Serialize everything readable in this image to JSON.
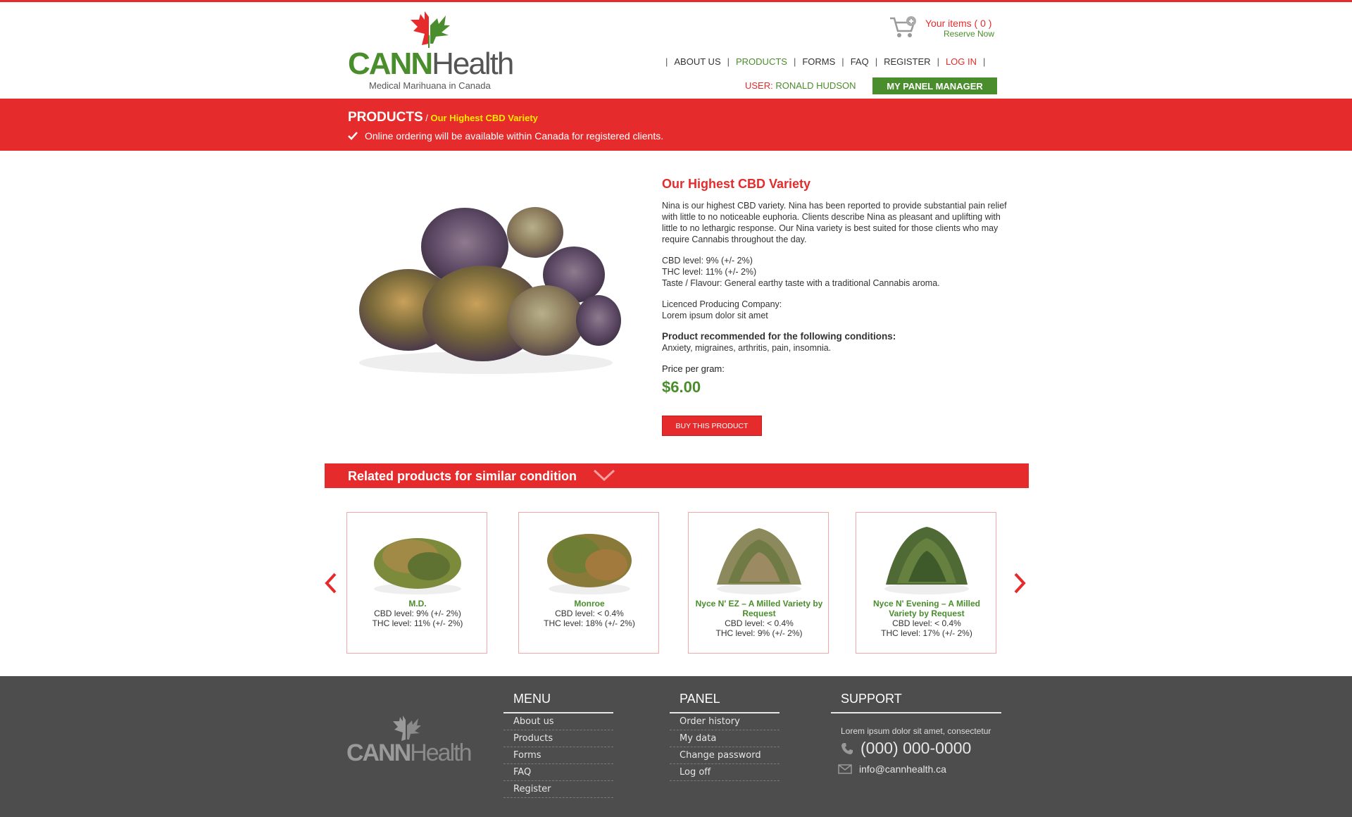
{
  "colors": {
    "brand_red": "#e52b2b",
    "brand_green": "#4a8d2c",
    "footer_bg": "#4d4d4d"
  },
  "header": {
    "logo": {
      "cann": "CANN",
      "health": "Health",
      "tagline": "Medical Marihuana in Canada"
    },
    "cart": {
      "items_label": "Your items ( 0 )",
      "reserve_label": "Reserve Now",
      "icon": "cart-icon"
    },
    "nav": [
      {
        "label": "ABOUT US"
      },
      {
        "label": "PRODUCTS"
      },
      {
        "label": "FORMS"
      },
      {
        "label": "FAQ"
      },
      {
        "label": "REGISTER"
      },
      {
        "label": "LOG IN"
      }
    ],
    "user": {
      "label": "USER:",
      "name": "RONALD HUDSON"
    },
    "panel_button": "MY PANEL  MANAGER"
  },
  "band": {
    "title": "PRODUCTS",
    "separator": " / ",
    "crumb": "Our Highest CBD Variety",
    "note": "Online ordering will be available within Canada for registered clients."
  },
  "product": {
    "title": "Our Highest CBD Variety",
    "description": "Nina is our highest CBD variety. Nina has been reported to provide substantial pain relief with little to no noticeable euphoria. Clients describe Nina as pleasant and uplifting with little to no lethargic response. Our Nina variety is best suited for those clients who may require Cannabis throughout the day.",
    "cbd": "CBD level: 9% (+/- 2%)",
    "thc": "THC level: 11% (+/- 2%)",
    "taste": "Taste / Flavour: General earthy taste with a traditional Cannabis aroma.",
    "company_label": "Licenced Producing Company:",
    "company": "Lorem ipsum dolor sit amet",
    "conditions_label": "Product recommended for the following conditions:",
    "conditions": "Anxiety, migraines, arthritis, pain, insomnia.",
    "price_label": "Price per gram:",
    "price": "$6.00",
    "buy_button": "BUY THIS PRODUCT"
  },
  "related": {
    "title": "Related products for similar condition",
    "items": [
      {
        "name": "M.D.",
        "cbd": "CBD level: 9% (+/- 2%)",
        "thc": "THC level: 11% (+/- 2%)"
      },
      {
        "name": "Monroe",
        "cbd": "CBD level: < 0.4%",
        "thc": "THC level: 18% (+/- 2%)"
      },
      {
        "name": "Nyce N' EZ – A Milled Variety by Request",
        "cbd": "CBD level: < 0.4%",
        "thc": "THC level: 9% (+/- 2%)"
      },
      {
        "name": "Nyce N' Evening – A Milled Variety by Request",
        "cbd": "CBD level: < 0.4%",
        "thc": "THC level: 17% (+/- 2%)"
      }
    ]
  },
  "footer": {
    "menu": {
      "title": "MENU",
      "items": [
        "About us",
        "Products",
        "Forms",
        "FAQ",
        "Register"
      ]
    },
    "panel": {
      "title": "PANEL",
      "items": [
        "Order history",
        "My data",
        "Change password",
        "Log off"
      ]
    },
    "support": {
      "title": "SUPPORT",
      "text": "Lorem ipsum dolor sit amet, consectetur",
      "phone": "(000) 000-0000",
      "email": "info@cannhealth.ca"
    }
  }
}
